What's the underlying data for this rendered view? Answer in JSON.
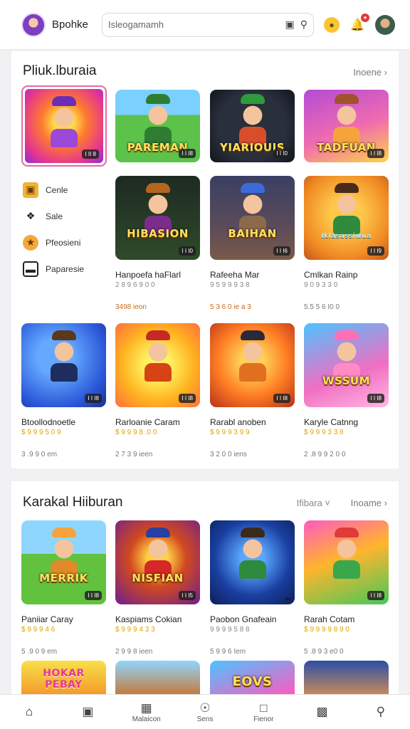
{
  "header": {
    "brand": "Bpohke",
    "search_value": "Isleogamamh"
  },
  "section1": {
    "title": "Pliuk.lburaia",
    "see_all": "Inoene",
    "featured_tag": "I II 8",
    "side_items": [
      {
        "label": "Cenle",
        "icon": "gamepad-icon"
      },
      {
        "label": "Sale",
        "icon": "tag-icon"
      },
      {
        "label": "Pfeosieni",
        "icon": "trophy-icon"
      },
      {
        "label": "Paparesie",
        "icon": "laptop-icon"
      }
    ],
    "row1": [
      {
        "art": "PAREMAN",
        "tag": "I I I8"
      },
      {
        "art": "YIARIOUIS",
        "tag": "I I I0"
      },
      {
        "art": "TADFUAN",
        "tag": "I I I8"
      }
    ],
    "row2": [
      {
        "art": "HIBASION",
        "tag": "I I I0",
        "title": "Hanpoefa haFlarl",
        "sub": "2 8 9 6 9 0 0",
        "price": "3498 ieon"
      },
      {
        "art": "BAIHAN",
        "tag": "I I I6",
        "title": "Rafeeha Mar",
        "sub": "9 5 9 9 9 3 8",
        "price": "5 3 6 0 ie a 3"
      },
      {
        "art": "Iklasassiwua",
        "tag": "I I I9",
        "title": "Cmlkan Rainp",
        "sub": "9 0 9 3 3 0",
        "price": "5.5 5 6 I0 0"
      }
    ],
    "row3": [
      {
        "art": "",
        "tag": "I I I8",
        "title": "Btoollodnoetle",
        "sub": "$ 9 9 9 5 0 9",
        "price": "3 .9 9 0 em"
      },
      {
        "art": "",
        "tag": "I I I8",
        "title": "Rarloanie Caram",
        "sub": "$ 9 9 9 8 .0 0",
        "price": "2 7 3 9 ieen"
      },
      {
        "art": "",
        "tag": "I I I8",
        "title": "Rarabl anoben",
        "sub": "$ 9 9 9 3 9 9",
        "price": "3 2 0 0 iens"
      },
      {
        "art": "WSSUM",
        "tag": "I I I8",
        "title": "Karyle Catnng",
        "sub": "$ 9 9 9 3 3 8",
        "price": "2 .8 9 9 2 0 0"
      }
    ]
  },
  "section2": {
    "title": "Karakal Hiiburan",
    "filter": "Ifibara",
    "see_all": "Inoame",
    "row1": [
      {
        "art": "MERRIK",
        "tag": "I I I8",
        "title": "Paniiar Caray",
        "sub": "$ 9 9 9 4 6",
        "price": "5 .9 0 9 em"
      },
      {
        "art": "NISFIAN",
        "tag": "I I I5",
        "title": "Kaspiams Cokian",
        "sub": "$ 9 9 9 4 3 3",
        "price": "2 9 9 8 ieen"
      },
      {
        "art": "",
        "tag": "",
        "title": "Paobon Gnafeain",
        "sub": "9 9 9 9 5 8 8",
        "price": "5 9 9 6 Iem"
      },
      {
        "art": "",
        "tag": "I I I8",
        "title": "Rarah Cotam",
        "sub": "$ 9 9 9 9 8 9 0",
        "price": "5 .8 9 3 e0 0"
      }
    ],
    "row2": [
      {
        "art": "HOKAR PEBAY"
      },
      {
        "art": ""
      },
      {
        "art": "EOVS"
      },
      {
        "art": ""
      }
    ]
  },
  "bottom_nav": [
    {
      "label": "",
      "icon": "home-icon"
    },
    {
      "label": "",
      "icon": "chat-icon"
    },
    {
      "label": "Malaicon",
      "icon": "grid-icon"
    },
    {
      "label": "Sens",
      "icon": "compass-icon"
    },
    {
      "label": "Fienor",
      "icon": "message-icon"
    },
    {
      "label": "",
      "icon": "image-icon"
    },
    {
      "label": "",
      "icon": "search-icon"
    }
  ]
}
